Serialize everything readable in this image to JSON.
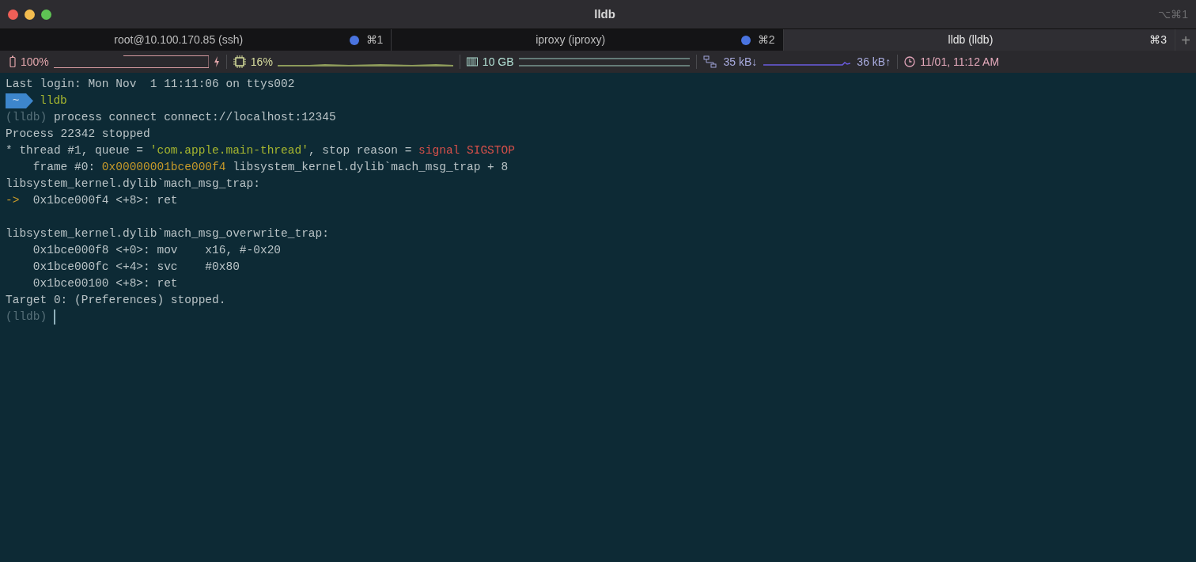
{
  "window": {
    "title": "lldb",
    "shortcut": "⌥⌘1"
  },
  "tabs": [
    {
      "label": "root@10.100.170.85 (ssh)",
      "shortcut": "⌘1",
      "has_activity": true,
      "selected": false
    },
    {
      "label": "iproxy (iproxy)",
      "shortcut": "⌘2",
      "has_activity": true,
      "selected": false
    },
    {
      "label": "lldb (lldb)",
      "shortcut": "⌘3",
      "has_activity": false,
      "selected": true
    }
  ],
  "new_tab": "+",
  "status_bar": {
    "battery": {
      "text": "100%"
    },
    "cpu": {
      "text": "16%"
    },
    "memory": {
      "text": "10 GB"
    },
    "network": {
      "down": "35 kB↓",
      "up": "36 kB↑"
    },
    "clock": {
      "text": "11/01, 11:12 AM"
    }
  },
  "terminal": {
    "lines": [
      {
        "segments": [
          {
            "kind": "plain",
            "text": "Last login: Mon Nov  1 11:11:06 on ttys002"
          }
        ]
      },
      {
        "segments": [
          {
            "kind": "prompt",
            "text": "~"
          },
          {
            "kind": "green",
            "text": "lldb"
          }
        ]
      },
      {
        "segments": [
          {
            "kind": "dim",
            "text": "(lldb)"
          },
          {
            "kind": "plain",
            "text": " process connect connect://localhost:12345"
          }
        ]
      },
      {
        "segments": [
          {
            "kind": "plain",
            "text": "Process 22342 stopped"
          }
        ]
      },
      {
        "segments": [
          {
            "kind": "plain",
            "text": "* thread #1, queue = "
          },
          {
            "kind": "green",
            "text": "'com.apple.main-thread'"
          },
          {
            "kind": "plain",
            "text": ", stop reason = "
          },
          {
            "kind": "red",
            "text": "signal SIGSTOP"
          }
        ]
      },
      {
        "segments": [
          {
            "kind": "plain",
            "text": "    frame #0: "
          },
          {
            "kind": "orange",
            "text": "0x00000001bce000f4"
          },
          {
            "kind": "plain",
            "text": " libsystem_kernel.dylib`mach_msg_trap + 8"
          }
        ]
      },
      {
        "segments": [
          {
            "kind": "plain",
            "text": "libsystem_kernel.dylib`mach_msg_trap:"
          }
        ]
      },
      {
        "segments": [
          {
            "kind": "orange",
            "text": "->"
          },
          {
            "kind": "plain",
            "text": "  0x1bce000f4 <+8>: ret"
          }
        ]
      },
      {
        "kind": "blank"
      },
      {
        "segments": [
          {
            "kind": "plain",
            "text": "libsystem_kernel.dylib`mach_msg_overwrite_trap:"
          }
        ]
      },
      {
        "segments": [
          {
            "kind": "plain",
            "text": "    0x1bce000f8 <+0>: mov    x16, #-0x20"
          }
        ]
      },
      {
        "segments": [
          {
            "kind": "plain",
            "text": "    0x1bce000fc <+4>: svc    #0x80"
          }
        ]
      },
      {
        "segments": [
          {
            "kind": "plain",
            "text": "    0x1bce00100 <+8>: ret"
          }
        ]
      },
      {
        "segments": [
          {
            "kind": "plain",
            "text": "Target 0: (Preferences) stopped."
          }
        ]
      },
      {
        "segments": [
          {
            "kind": "dim",
            "text": "(lldb)"
          },
          {
            "kind": "cursor"
          }
        ]
      }
    ]
  }
}
